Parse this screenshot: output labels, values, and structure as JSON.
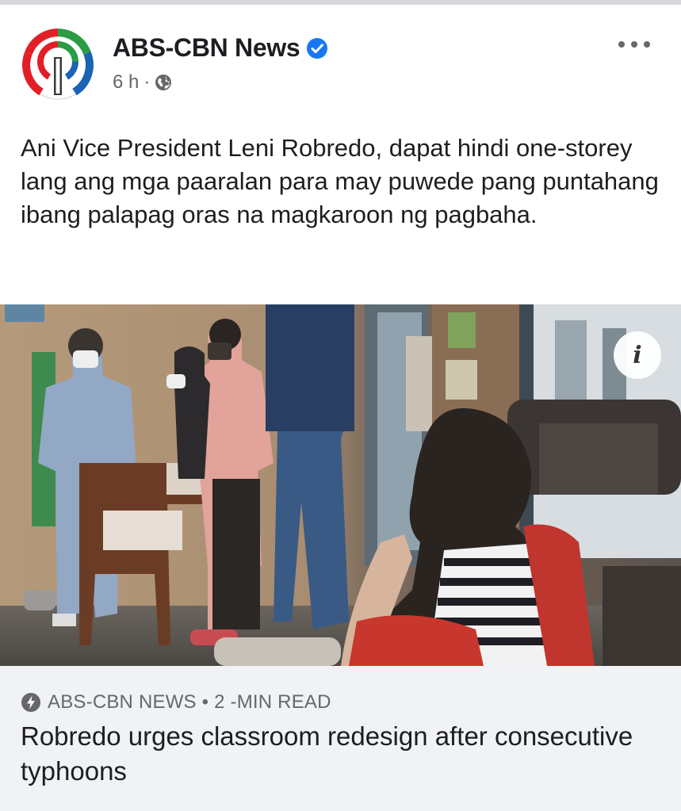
{
  "post": {
    "page_name": "ABS-CBN News",
    "time": "6 h",
    "separator": "·",
    "caption": "Ani Vice President Leni Robredo, dapat hindi one-storey lang ang mga paaralan para may puwede pang puntahang ibang palapag oras na magkaroon ng pagbaha.",
    "verified_color": "#1877f2"
  },
  "icons": {
    "logo": "abs-cbn-logo",
    "verified": "verified-badge-icon",
    "privacy": "globe-icon",
    "menu": "more-options-icon",
    "info": "info-icon",
    "source": "bolt-icon"
  },
  "photo": {
    "info_glyph": "i"
  },
  "link": {
    "source": "ABS-CBN NEWS • 2 -MIN READ",
    "title": "Robredo urges classroom redesign after consecutive typhoons"
  }
}
